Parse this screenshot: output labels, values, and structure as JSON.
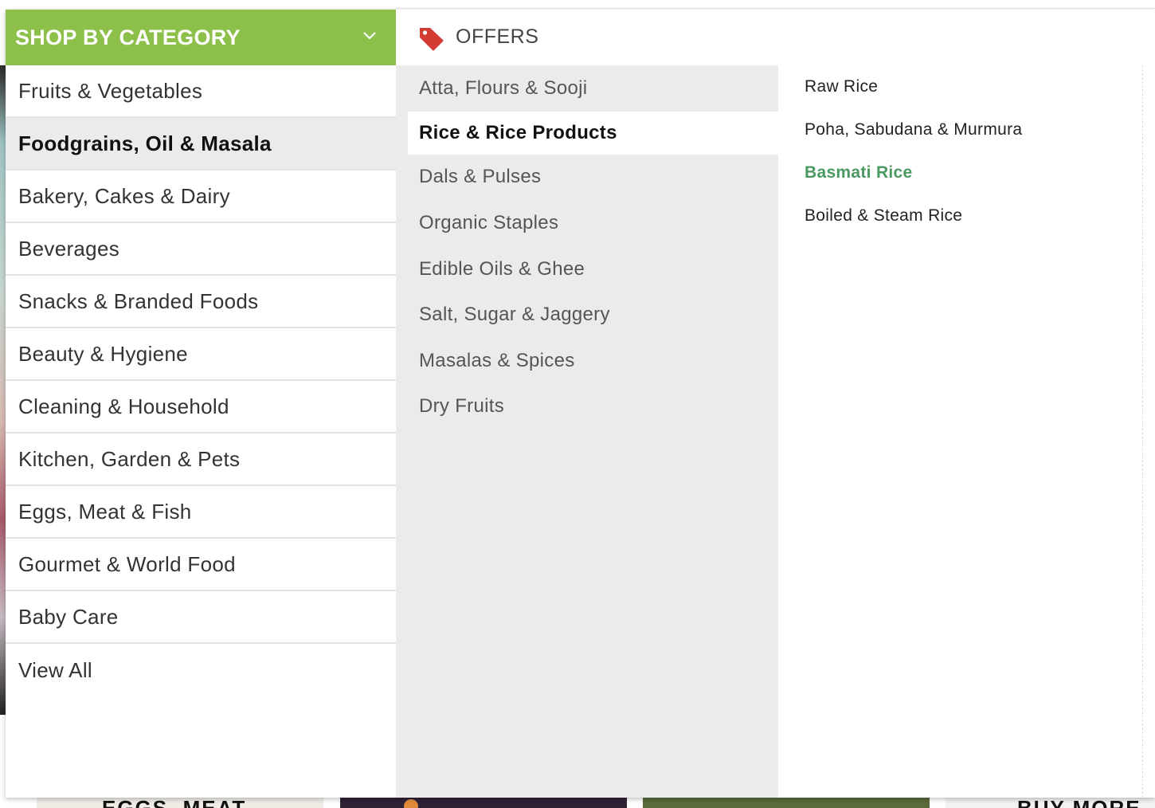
{
  "header": {
    "category_label": "SHOP BY CATEGORY",
    "offers_label": "OFFERS"
  },
  "categories": [
    {
      "label": "Fruits & Vegetables"
    },
    {
      "label": "Foodgrains, Oil & Masala",
      "active": true
    },
    {
      "label": "Bakery, Cakes & Dairy"
    },
    {
      "label": "Beverages"
    },
    {
      "label": "Snacks & Branded Foods"
    },
    {
      "label": "Beauty & Hygiene"
    },
    {
      "label": "Cleaning & Household"
    },
    {
      "label": "Kitchen, Garden & Pets"
    },
    {
      "label": "Eggs, Meat & Fish"
    },
    {
      "label": "Gourmet & World Food"
    },
    {
      "label": "Baby Care"
    },
    {
      "label": "View All"
    }
  ],
  "subcategories": [
    {
      "label": "Atta, Flours & Sooji"
    },
    {
      "label": "Rice & Rice Products",
      "active": true
    },
    {
      "label": "Dals & Pulses"
    },
    {
      "label": "Organic Staples"
    },
    {
      "label": "Edible Oils & Ghee"
    },
    {
      "label": "Salt, Sugar & Jaggery"
    },
    {
      "label": "Masalas & Spices"
    },
    {
      "label": "Dry Fruits"
    }
  ],
  "leaf_items": [
    {
      "label": "Raw Rice"
    },
    {
      "label": "Poha, Sabudana & Murmura"
    },
    {
      "label": "Basmati Rice",
      "highlight": true
    },
    {
      "label": "Boiled & Steam Rice"
    }
  ],
  "background_banners": {
    "banner1_text": "EGGS, MEAT",
    "banner4_text": "BUY MORE"
  },
  "colors": {
    "category_header": "#8dc04a",
    "offers_tag": "#d23c33",
    "highlight_link": "#4a9a62"
  },
  "icons": {
    "chevron": "chevron-down-icon",
    "offers": "tag-icon"
  }
}
